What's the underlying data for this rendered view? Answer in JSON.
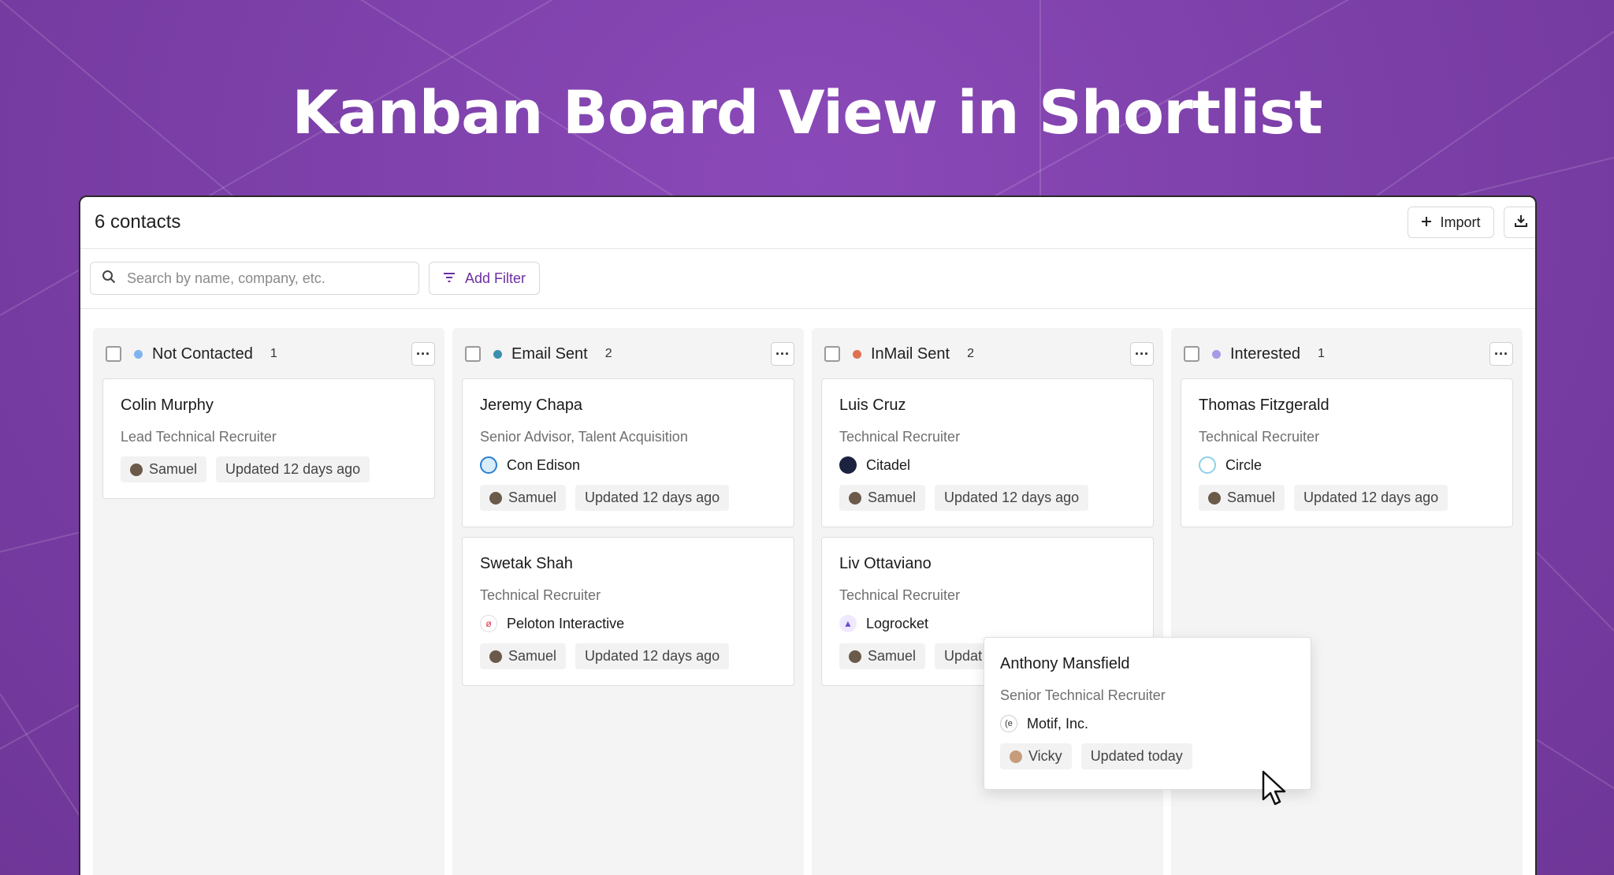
{
  "headline": "Kanban Board View in Shortlist",
  "topbar": {
    "title": "6 contacts",
    "import_label": "Import",
    "import_icon": "plus-icon",
    "download_icon": "download-icon"
  },
  "filterbar": {
    "search_placeholder": "Search by name, company, etc.",
    "filter_label": "Add Filter"
  },
  "colors": {
    "background": "#7b3fa6",
    "accent": "#6b2fa0"
  },
  "columns": [
    {
      "title": "Not Contacted",
      "count": "1",
      "dot_color": "#7fb3f0",
      "cards": [
        {
          "name": "Colin Murphy",
          "role": "Lead Technical Recruiter",
          "company": "",
          "owner": "Samuel",
          "updated": "Updated 12 days ago"
        }
      ]
    },
    {
      "title": "Email Sent",
      "count": "2",
      "dot_color": "#3b8fb0",
      "cards": [
        {
          "name": "Jeremy Chapa",
          "role": "Senior Advisor, Talent Acquisition",
          "company": "Con Edison",
          "owner": "Samuel",
          "updated": "Updated 12 days ago"
        },
        {
          "name": "Swetak Shah",
          "role": "Technical Recruiter",
          "company": "Peloton Interactive",
          "owner": "Samuel",
          "updated": "Updated 12 days ago"
        }
      ]
    },
    {
      "title": "InMail Sent",
      "count": "2",
      "dot_color": "#e0704f",
      "cards": [
        {
          "name": "Luis Cruz",
          "role": "Technical Recruiter",
          "company": "Citadel",
          "owner": "Samuel",
          "updated": "Updated 12 days ago"
        },
        {
          "name": "Liv Ottaviano",
          "role": "Technical Recruiter",
          "company": "Logrocket",
          "owner": "Samuel",
          "updated": "Updat"
        }
      ]
    },
    {
      "title": "Interested",
      "count": "1",
      "dot_color": "#a89ae6",
      "cards": [
        {
          "name": "Thomas Fitzgerald",
          "role": "Technical Recruiter",
          "company": "Circle",
          "owner": "Samuel",
          "updated": "Updated 12 days ago"
        }
      ]
    }
  ],
  "dragging_card": {
    "name": "Anthony Mansfield",
    "role": "Senior Technical Recruiter",
    "company": "Motif, Inc.",
    "owner": "Vicky",
    "updated": "Updated today"
  }
}
